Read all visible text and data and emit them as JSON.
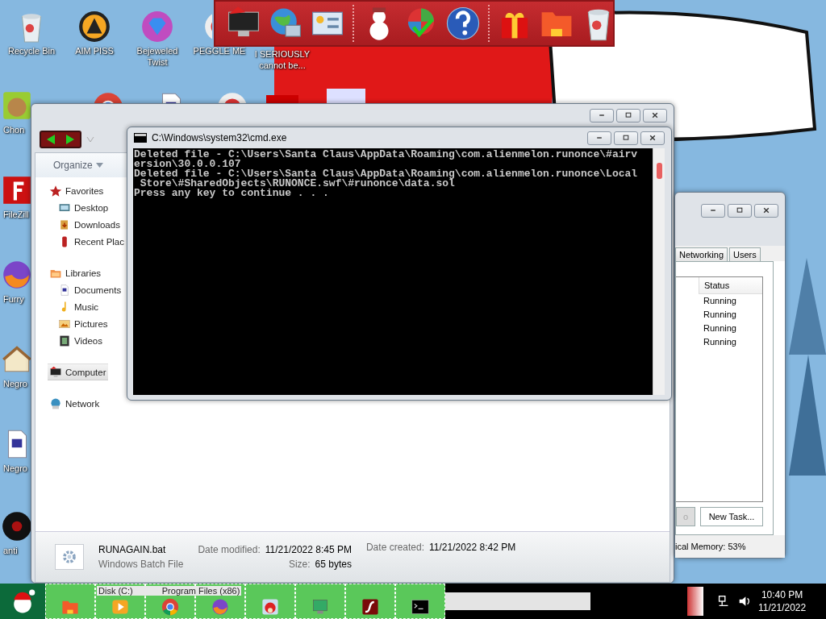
{
  "desktop_icons": [
    {
      "label": "Recycle Bin",
      "kind": "bin"
    },
    {
      "label": "AIM PISS",
      "kind": "aim"
    },
    {
      "label": "Bejeweled Twist",
      "kind": "gem"
    },
    {
      "label": "PEGGLE ME",
      "kind": "ball"
    },
    {
      "label": "I SERIOUSLY cannot be...",
      "kind": "none"
    },
    {
      "label": "Chon",
      "kind": "game"
    },
    {
      "label": "FileZill",
      "kind": "ftp"
    },
    {
      "label": "Furry",
      "kind": "fox"
    },
    {
      "label": "Negro",
      "kind": "house"
    },
    {
      "label": "Negro",
      "kind": "doc"
    },
    {
      "label": "anti",
      "kind": "disc"
    }
  ],
  "dock": {
    "groups": [
      [
        {
          "kind": "computer"
        },
        {
          "kind": "globe"
        },
        {
          "kind": "panel"
        }
      ],
      [
        {
          "kind": "snowman"
        },
        {
          "kind": "windows"
        },
        {
          "kind": "help"
        }
      ],
      [
        {
          "kind": "gift"
        },
        {
          "kind": "folder"
        },
        {
          "kind": "bin"
        }
      ]
    ]
  },
  "explorer": {
    "organize": "Organize",
    "nav": [
      {
        "label": "Favorites",
        "kind": "star",
        "selected": false,
        "children": [
          {
            "label": "Desktop",
            "kind": "desktop",
            "selected": false
          },
          {
            "label": "Downloads",
            "kind": "download",
            "selected": false
          },
          {
            "label": "Recent Plac",
            "kind": "recent",
            "selected": false
          }
        ]
      },
      {
        "label": "Libraries",
        "kind": "library",
        "selected": false,
        "children": [
          {
            "label": "Documents",
            "kind": "doc",
            "selected": false
          },
          {
            "label": "Music",
            "kind": "music",
            "selected": false
          },
          {
            "label": "Pictures",
            "kind": "pictures",
            "selected": false
          },
          {
            "label": "Videos",
            "kind": "videos",
            "selected": false
          }
        ]
      },
      {
        "label": "Computer",
        "kind": "computer",
        "selected": true
      },
      {
        "label": "Network",
        "kind": "network",
        "selected": false
      }
    ],
    "details": {
      "file_name": "RUNAGAIN.bat",
      "file_type": "Windows Batch File",
      "fields": [
        {
          "label": "Date modified:",
          "value": "11/21/2022 8:45 PM"
        },
        {
          "label": "Size:",
          "value": "65 bytes"
        },
        {
          "label": "Date created:",
          "value": "11/21/2022 8:42 PM"
        }
      ]
    }
  },
  "cmd": {
    "title": "C:\\Windows\\system32\\cmd.exe",
    "lines": [
      "Deleted file - C:\\Users\\Santa Claus\\AppData\\Roaming\\com.alienmelon.runonce\\#airv",
      "ersion\\30.0.0.107",
      "Deleted file - C:\\Users\\Santa Claus\\AppData\\Roaming\\com.alienmelon.runonce\\Local",
      " Store\\#SharedObjects\\RUNONCE.swf\\#runonce\\data.sol",
      "Press any key to continue . . ."
    ]
  },
  "task_manager": {
    "tabs": [
      {
        "label": "Networking",
        "selected": false
      },
      {
        "label": "Users",
        "selected": false
      }
    ],
    "column": "Status",
    "rows": [
      "Running",
      "Running",
      "Running",
      "Running"
    ],
    "buttons": [
      {
        "label": "o",
        "disabled": true
      },
      {
        "label": "New Task...",
        "disabled": false
      }
    ],
    "status": "ical Memory: 53%"
  },
  "taskbar": {
    "preview": [
      "Disk (C:)",
      "Program Files (x86)"
    ],
    "apps": [
      {
        "kind": "folder"
      },
      {
        "kind": "media"
      },
      {
        "kind": "chrome"
      },
      {
        "kind": "firefox"
      },
      {
        "kind": "bird"
      },
      {
        "kind": "monitor"
      },
      {
        "kind": "flash"
      },
      {
        "kind": "cmd"
      }
    ],
    "clock": {
      "time": "10:40 PM",
      "date": "11/21/2022"
    }
  }
}
